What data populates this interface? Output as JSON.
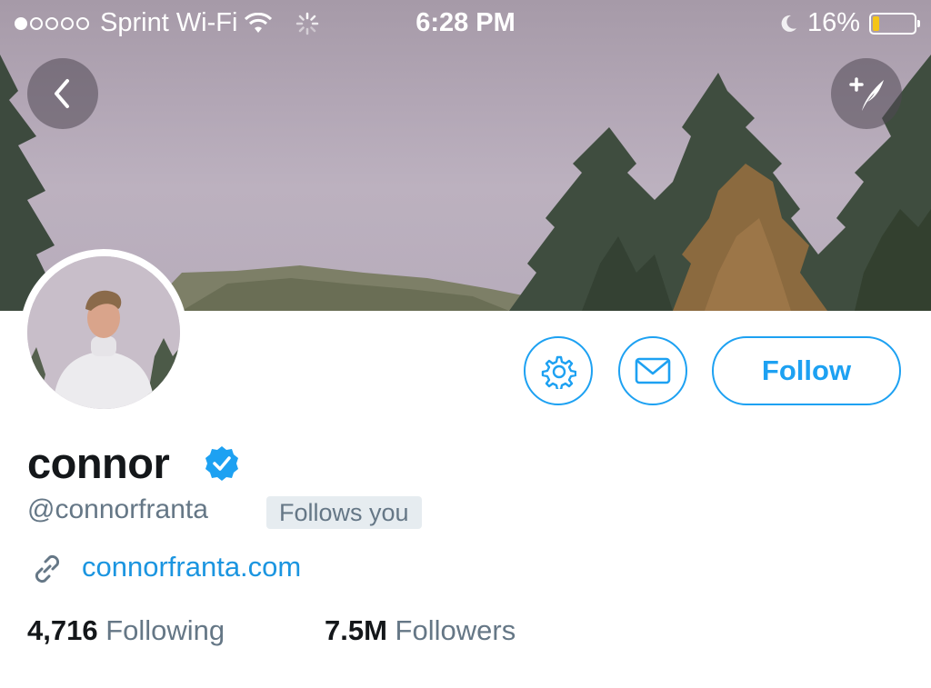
{
  "status_bar": {
    "carrier": "Sprint Wi-Fi",
    "time": "6:28 PM",
    "battery_percent": "16%",
    "battery_level": 0.16,
    "signal_bars_filled": 1,
    "signal_bars_total": 5
  },
  "header": {
    "back_icon": "chevron-left-icon",
    "compose_icon": "compose-tweet-icon"
  },
  "profile": {
    "display_name": "connor",
    "handle": "@connorfranta",
    "follows_you": "Follows you",
    "website": "connorfranta.com",
    "verified": true
  },
  "actions": {
    "settings_icon": "gear-icon",
    "message_icon": "envelope-icon",
    "follow_label": "Follow"
  },
  "stats": {
    "following_count": "4,716",
    "following_label": "Following",
    "followers_count": "7.5M",
    "followers_label": "Followers"
  },
  "colors": {
    "accent": "#1da1f2",
    "link": "#1b95e0",
    "muted": "#657786",
    "text": "#14171a",
    "badge_bg": "#e6ecf0",
    "battery_low": "#f5c518"
  }
}
